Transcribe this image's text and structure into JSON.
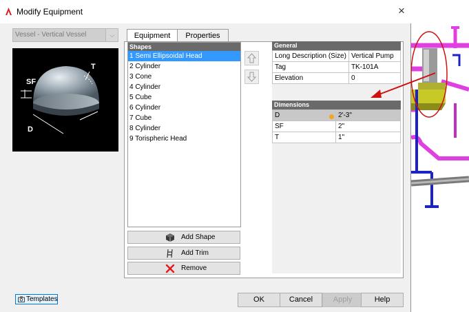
{
  "dialog": {
    "title": "Modify Equipment",
    "close_label": "×"
  },
  "type_select": {
    "value": "Vessel - Vertical Vessel"
  },
  "preview": {
    "labels": {
      "t": "T",
      "sf": "SF",
      "d": "D"
    }
  },
  "tabs": [
    {
      "label": "Equipment",
      "active": true
    },
    {
      "label": "Properties",
      "active": false
    }
  ],
  "shapes": {
    "header": "Shapes",
    "items": [
      "1 Semi Ellipsoidal Head",
      "2 Cylinder",
      "3 Cone",
      "4 Cylinder",
      "5 Cube",
      "6 Cylinder",
      "7 Cube",
      "8 Cylinder",
      "9 Torispheric Head"
    ],
    "selected_index": 0
  },
  "buttons": {
    "add_shape": "Add Shape",
    "add_trim": "Add Trim",
    "remove": "Remove",
    "ok": "OK",
    "cancel": "Cancel",
    "apply": "Apply",
    "help": "Help",
    "templates": "Templates"
  },
  "general": {
    "header": "General",
    "rows": [
      {
        "key": "Long Description (Size)",
        "value": "Vertical Pump"
      },
      {
        "key": "Tag",
        "value": "TK-101A"
      },
      {
        "key": "Elevation",
        "value": "0"
      }
    ]
  },
  "dimensions": {
    "header": "Dimensions",
    "rows": [
      {
        "key": "D",
        "value": "2'-3\""
      },
      {
        "key": "SF",
        "value": "2\""
      },
      {
        "key": "T",
        "value": "1\""
      }
    ]
  },
  "colors": {
    "accent": "#3399ff",
    "annotation": "#cc1111",
    "pipe_magenta": "#e040e0",
    "pipe_blue": "#1a22c8"
  }
}
